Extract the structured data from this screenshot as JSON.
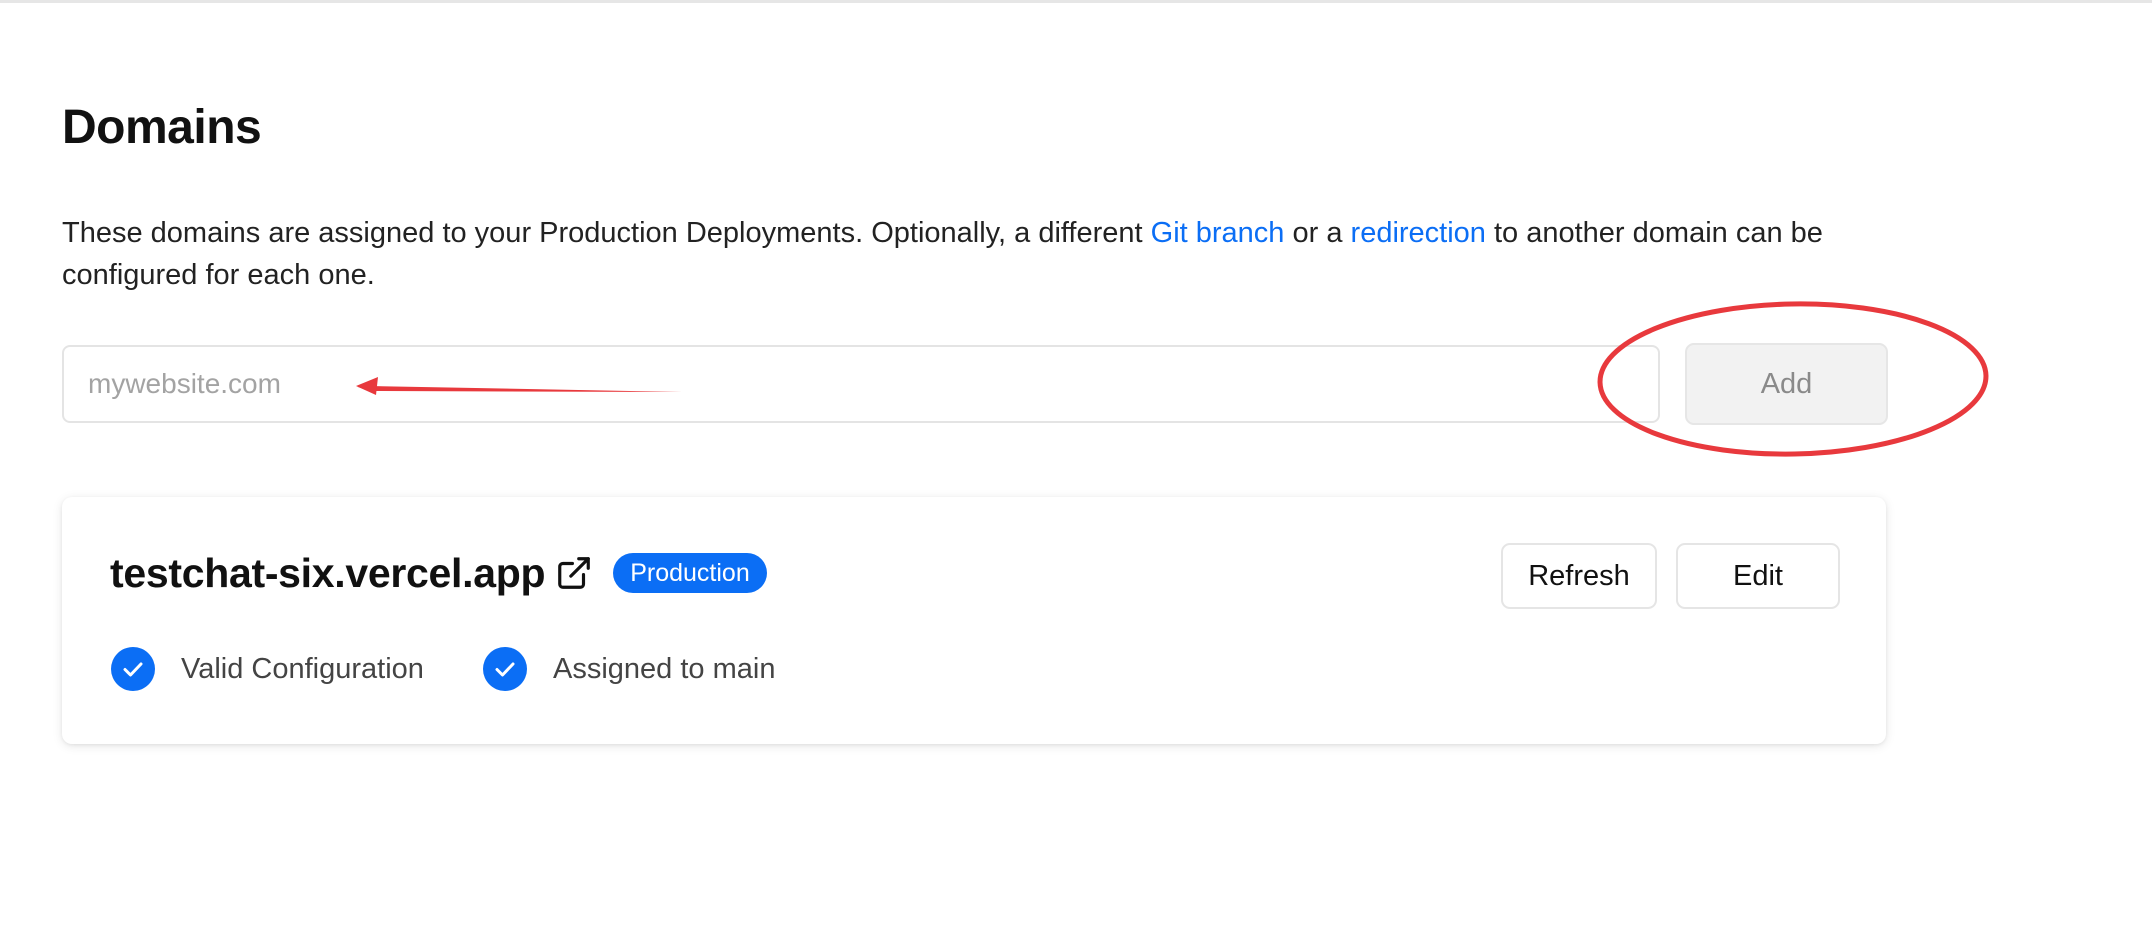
{
  "page": {
    "title": "Domains",
    "description": {
      "before": "These domains are assigned to your Production Deployments. Optionally, a different ",
      "link1": "Git branch",
      "middle": " or a ",
      "link2": "redirection",
      "after": " to another domain can be configured for each one."
    }
  },
  "add_form": {
    "input_placeholder": "mywebsite.com",
    "input_value": "",
    "add_label": "Add"
  },
  "domain_card": {
    "domain": "testchat-six.vercel.app",
    "badge": "Production",
    "refresh_label": "Refresh",
    "edit_label": "Edit",
    "statuses": [
      {
        "label": "Valid Configuration",
        "icon": "check-circle-icon"
      },
      {
        "label": "Assigned to main",
        "icon": "check-circle-icon"
      }
    ]
  },
  "colors": {
    "accent": "#0b6ef5",
    "annotation": "#e8393d"
  }
}
